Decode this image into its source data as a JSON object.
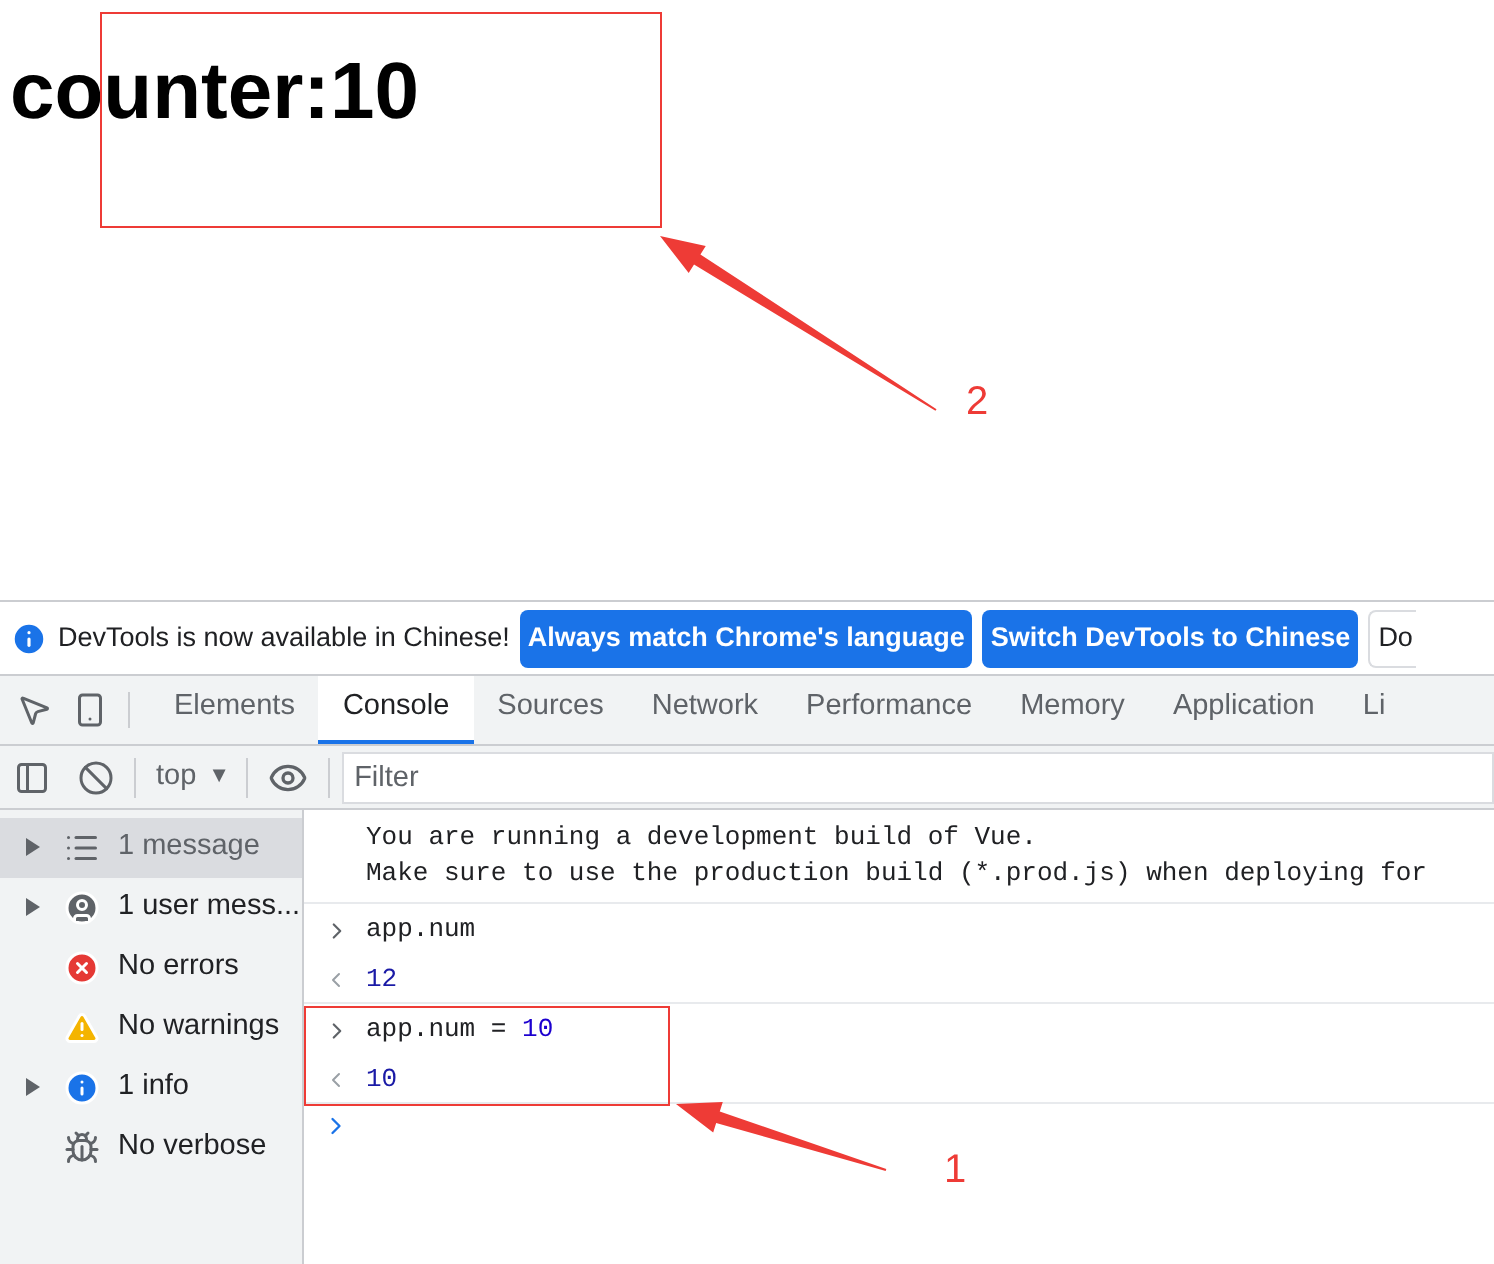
{
  "page": {
    "heading": "counter:10"
  },
  "annotations": [
    {
      "label": "2"
    },
    {
      "label": "1"
    }
  ],
  "devtools": {
    "notice": {
      "text": "DevTools is now available in Chinese!",
      "buttons": [
        {
          "label": "Always match Chrome's language",
          "kind": "primary"
        },
        {
          "label": "Switch DevTools to Chinese",
          "kind": "primary"
        },
        {
          "label": "Do",
          "kind": "outline"
        }
      ]
    },
    "tabs": [
      {
        "label": "Elements",
        "selected": false
      },
      {
        "label": "Console",
        "selected": true
      },
      {
        "label": "Sources",
        "selected": false
      },
      {
        "label": "Network",
        "selected": false
      },
      {
        "label": "Performance",
        "selected": false
      },
      {
        "label": "Memory",
        "selected": false
      },
      {
        "label": "Application",
        "selected": false
      },
      {
        "label": "Li",
        "selected": false
      }
    ],
    "toolbar": {
      "context": "top",
      "context_caret": "▼",
      "filter_placeholder": "Filter"
    },
    "sidebar": [
      {
        "kind": "messages",
        "label": "1 message",
        "expandable": true,
        "selected": true
      },
      {
        "kind": "user",
        "label": "1 user mess...",
        "expandable": true,
        "selected": false
      },
      {
        "kind": "errors",
        "label": "No errors",
        "expandable": false,
        "selected": false
      },
      {
        "kind": "warnings",
        "label": "No warnings",
        "expandable": false,
        "selected": false
      },
      {
        "kind": "info",
        "label": "1 info",
        "expandable": true,
        "selected": false
      },
      {
        "kind": "verbose",
        "label": "No verbose",
        "expandable": false,
        "selected": false
      }
    ],
    "console": [
      {
        "kind": "log",
        "lines": [
          "You are running a development build of Vue.",
          "Make sure to use the production build (*.prod.js) when deploying for"
        ]
      },
      {
        "kind": "input",
        "tokens": [
          {
            "kind": "plain",
            "text": "app.num"
          }
        ]
      },
      {
        "kind": "output",
        "text": "12"
      },
      {
        "kind": "input",
        "tokens": [
          {
            "kind": "plain",
            "text": "app.num = "
          },
          {
            "kind": "number",
            "text": "10"
          }
        ]
      },
      {
        "kind": "output",
        "text": "10"
      },
      {
        "kind": "prompt"
      }
    ]
  }
}
